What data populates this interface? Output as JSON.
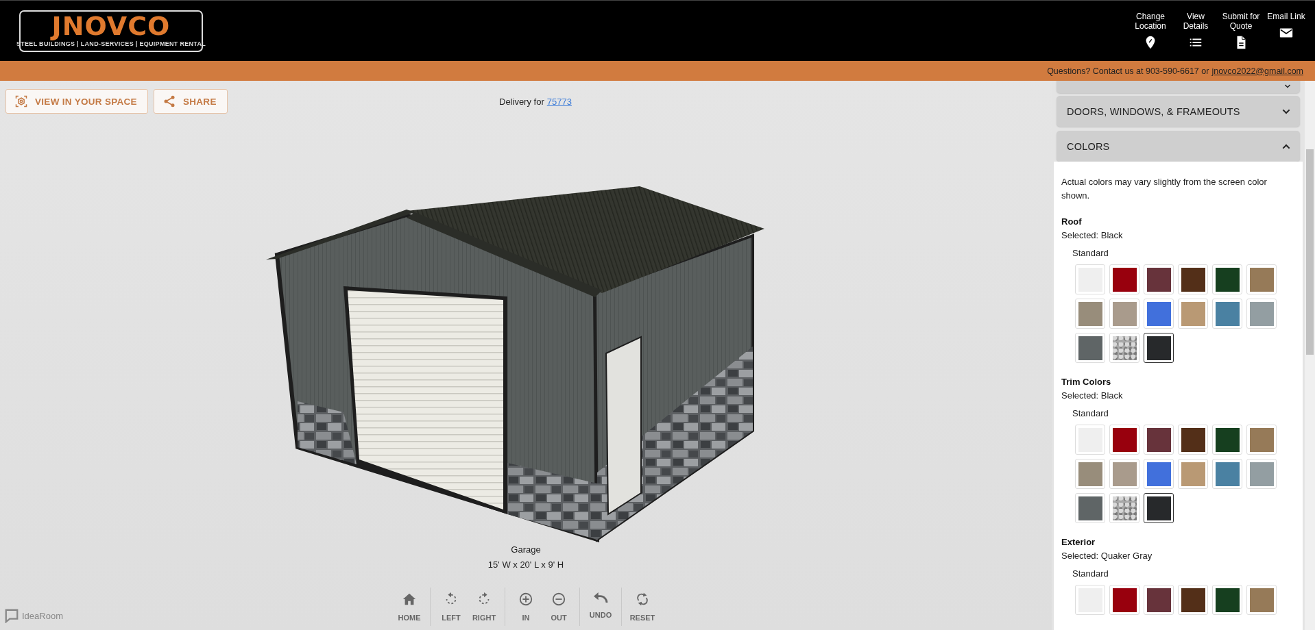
{
  "header": {
    "logo": {
      "name": "JNOVCO",
      "tagline": "STEEL BUILDINGS | LAND-SERVICES | EQUIPMENT RENTAL"
    },
    "nav": [
      {
        "label": "Change Location",
        "kind": "pin"
      },
      {
        "label": "View Details",
        "kind": "list"
      },
      {
        "label": "Submit for Quote",
        "kind": "document"
      },
      {
        "label": "Email Link",
        "kind": "mail"
      }
    ]
  },
  "contact_bar": {
    "text": "Questions? Contact us at 903-590-6617 or",
    "email": "jnovco2022@gmail.com"
  },
  "viewer": {
    "buttons": [
      {
        "label": "VIEW IN YOUR SPACE",
        "kind": "ar"
      },
      {
        "label": "SHARE",
        "kind": "share"
      }
    ],
    "delivery": {
      "text": "Delivery for",
      "zip": "75773"
    },
    "building": {
      "name": "Garage",
      "size": "15' W x 20' L x 9' H"
    },
    "controls": [
      [
        {
          "label": "HOME",
          "kind": "home"
        }
      ],
      [
        {
          "label": "LEFT",
          "kind": "rotate-left"
        },
        {
          "label": "RIGHT",
          "kind": "rotate-right"
        }
      ],
      [
        {
          "label": "IN",
          "kind": "zoom-in"
        },
        {
          "label": "OUT",
          "kind": "zoom-out"
        }
      ],
      [
        {
          "label": "UNDO",
          "kind": "undo"
        }
      ],
      [
        {
          "label": "RESET",
          "kind": "reset"
        }
      ]
    ],
    "branding": "IdeaRoom"
  },
  "panel": {
    "clipped_section": {
      "expanded": false
    },
    "sections": [
      {
        "title": "DOORS, WINDOWS, & FRAMEOUTS",
        "expanded": false
      },
      {
        "title": "COLORS",
        "expanded": true
      }
    ],
    "note": "Actual colors may vary slightly from the screen color shown.",
    "color_groups": [
      {
        "title": "Roof",
        "selected_text": "Selected: Black",
        "subgroup": "Standard",
        "swatches": [
          {
            "color": "#efefef",
            "kind": "solid",
            "selected": false
          },
          {
            "color": "#98000d",
            "kind": "solid",
            "selected": false
          },
          {
            "color": "#67333b",
            "kind": "solid",
            "selected": false
          },
          {
            "color": "#532f18",
            "kind": "solid",
            "selected": false
          },
          {
            "color": "#163f1f",
            "kind": "solid",
            "selected": false
          },
          {
            "color": "#967a58",
            "kind": "solid",
            "selected": false
          },
          {
            "color": "#988d7b",
            "kind": "solid",
            "selected": false
          },
          {
            "color": "#a99b8c",
            "kind": "solid",
            "selected": false
          },
          {
            "color": "#4170dc",
            "kind": "solid",
            "selected": false
          },
          {
            "color": "#b99974",
            "kind": "solid",
            "selected": false
          },
          {
            "color": "#4a81a2",
            "kind": "solid",
            "selected": false
          },
          {
            "color": "#939ea2",
            "kind": "solid",
            "selected": false
          },
          {
            "color": "#5f6566",
            "kind": "solid",
            "selected": false
          },
          {
            "color": "#a9a9a9",
            "kind": "texture",
            "selected": false
          },
          {
            "color": "#27292b",
            "kind": "solid",
            "selected": true
          }
        ]
      },
      {
        "title": "Trim Colors",
        "selected_text": "Selected: Black",
        "subgroup": "Standard",
        "swatches": [
          {
            "color": "#efefef",
            "kind": "solid",
            "selected": false
          },
          {
            "color": "#98000d",
            "kind": "solid",
            "selected": false
          },
          {
            "color": "#67333b",
            "kind": "solid",
            "selected": false
          },
          {
            "color": "#532f18",
            "kind": "solid",
            "selected": false
          },
          {
            "color": "#163f1f",
            "kind": "solid",
            "selected": false
          },
          {
            "color": "#967a58",
            "kind": "solid",
            "selected": false
          },
          {
            "color": "#988d7b",
            "kind": "solid",
            "selected": false
          },
          {
            "color": "#a99b8c",
            "kind": "solid",
            "selected": false
          },
          {
            "color": "#4170dc",
            "kind": "solid",
            "selected": false
          },
          {
            "color": "#b99974",
            "kind": "solid",
            "selected": false
          },
          {
            "color": "#4a81a2",
            "kind": "solid",
            "selected": false
          },
          {
            "color": "#939ea2",
            "kind": "solid",
            "selected": false
          },
          {
            "color": "#5f6566",
            "kind": "solid",
            "selected": false
          },
          {
            "color": "#a9a9a9",
            "kind": "texture",
            "selected": false
          },
          {
            "color": "#27292b",
            "kind": "solid",
            "selected": true
          }
        ]
      },
      {
        "title": "Exterior",
        "selected_text": "Selected: Quaker Gray",
        "subgroup": "Standard",
        "swatches": [
          {
            "color": "#efefef",
            "kind": "solid",
            "selected": false
          },
          {
            "color": "#98000d",
            "kind": "solid",
            "selected": false
          },
          {
            "color": "#67333b",
            "kind": "solid",
            "selected": false
          },
          {
            "color": "#532f18",
            "kind": "solid",
            "selected": false
          },
          {
            "color": "#163f1f",
            "kind": "solid",
            "selected": false
          },
          {
            "color": "#967a58",
            "kind": "solid",
            "selected": false
          }
        ]
      }
    ]
  }
}
